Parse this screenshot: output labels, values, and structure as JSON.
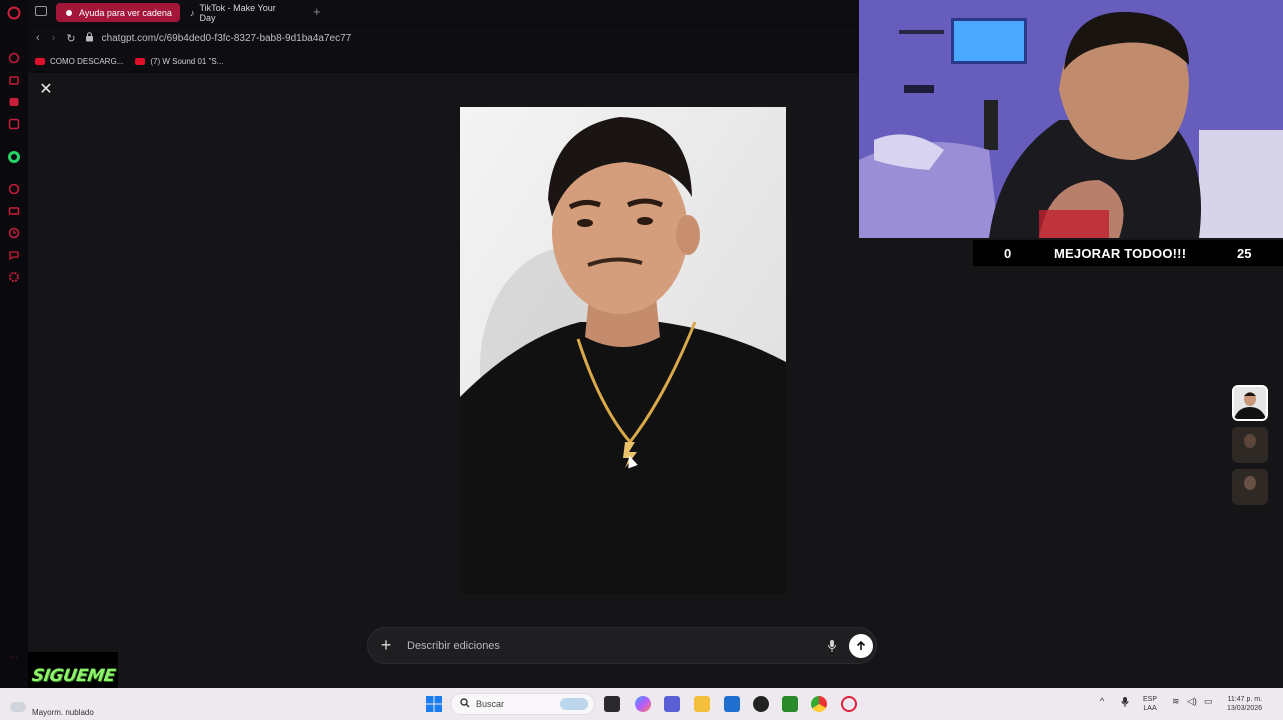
{
  "browser": {
    "tabs": [
      {
        "label": "Ayuda para ver cadena",
        "active": true
      },
      {
        "label": "TikTok - Make Your Day",
        "active": false
      }
    ],
    "url": "chatgpt.com/c/69b4ded0-f3fc-8327-bab8-9d1ba4a7ec77",
    "bookmarks": [
      {
        "label": "COMO DESCARG..."
      },
      {
        "label": "(7) W Sound 01 \"S..."
      }
    ],
    "sidebar_icons": [
      "opera-logo-icon",
      "bag-icon",
      "messenger-icon",
      "instagram-icon",
      "whatsapp-icon",
      "play-icon",
      "wallet-icon",
      "history-icon",
      "chat-icon",
      "settings-icon"
    ]
  },
  "editor": {
    "composer_placeholder": "Describir ediciones",
    "thumbnails": 3,
    "selected_thumbnail": 1
  },
  "stream": {
    "score_left": "0",
    "score_title": "MEJORAR TODOO!!!",
    "score_right": "25",
    "sigueme_label": "SIGUEME"
  },
  "taskbar": {
    "weather": "Mayorm. nublado",
    "search_label": "Buscar",
    "lang_line1": "ESP",
    "lang_line2": "LAA",
    "time": "11:47 p. m.",
    "date": "13/03/2026"
  },
  "colors": {
    "accent_tab": "#a3163a",
    "sigueme_green": "#8ef36b",
    "taskbar_bg": "#eee9ee"
  }
}
